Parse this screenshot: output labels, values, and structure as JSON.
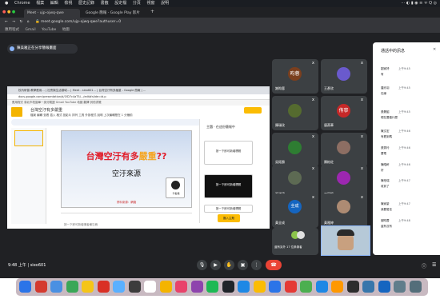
{
  "menubar": {
    "items": [
      "Chrome",
      "檔案",
      "編輯",
      "檢視",
      "歷史記錄",
      "書籤",
      "設定檔",
      "分頁",
      "視窗",
      "說明"
    ],
    "right": "⋯ ◐ ▮ ◉ ≡ ᯤ Q ◎"
  },
  "browser_tabs": [
    {
      "label": "Meet - ujp-ojwq-qwe",
      "color": "#35363a"
    },
    {
      "label": "Google 簡報 - Google Play 影片",
      "color": "#202124"
    }
  ],
  "address": {
    "url": "meet.google.com/ujp-ojwq-qwe?authuser=0"
  },
  "bookmarks": [
    "應用程式",
    "Gmail",
    "YouTube",
    "地圖"
  ],
  "meet": {
    "presenter": "陳美雅正在分享簡報畫面",
    "time": "9:48 上午",
    "meeting_code": "sieo601",
    "more_count": "還有另外 17 位參與者"
  },
  "shared": {
    "inner_tabs": [
      "校內研習-教學應用…",
      "社會與生活領域…",
      "Meet - sieo601…",
      "台灣空汙有多嚴重 - Google 簡報",
      "…"
    ],
    "inner_url": "docs.google.com/presentation/d/1fD7c4aT5J…/edit#slide=id.p",
    "inner_bookmarks": "應用程式  臺北市校園單一身分驗證  Gmail  YouTube  地圖  翻譯  其他書籤",
    "doc_title": "台灣空汙有多嚴重",
    "menu": "檔案 編輯 查看 插入 格式 投影片 排列 工具 外掛程式 說明  上次編輯是在 1 分鐘前",
    "slide_title_a": "台灣空汙有多",
    "slide_title_b": "嚴重",
    "slide_title_c": "??",
    "slide_sub": "空汙來源",
    "slide_footer": "資料來源：網路",
    "slide_badge": "平板機",
    "notes": "按一下即可新增講者備忘稿",
    "right_panel_title": "主題",
    "right_panel_sub": "在這份簡報中",
    "right_cards": [
      "按一下即可新增標題",
      "按一下即可新增標題",
      "按一下即可新增標題"
    ],
    "right_button": "匯入主題"
  },
  "participants": [
    {
      "name": "謝昀蓉",
      "initial": "昀蓉",
      "color": "#7b3f1e"
    },
    {
      "name": "王彥欣",
      "initial": "",
      "color": "#6a5acd"
    },
    {
      "name": "陳瑞玟",
      "initial": "",
      "color": "#556b2f"
    },
    {
      "name": "唐燕華",
      "initial": "侑寧",
      "color": "#c62828"
    },
    {
      "name": "吳銘勝",
      "initial": "",
      "color": "#2e7d32"
    },
    {
      "name": "陳彬佐",
      "initial": "",
      "color": "#8d6e63"
    },
    {
      "name": "張道瑋",
      "initial": "",
      "color": "#5d6a53"
    },
    {
      "name": "丁昱銘",
      "initial": "",
      "color": "#9c27b0"
    },
    {
      "name": "黃全成",
      "initial": "全成",
      "color": "#1565c0"
    },
    {
      "name": "黃雅婷",
      "initial": "",
      "color": "#ad8b73"
    }
  ],
  "chat": {
    "title": "通話中的訊息",
    "messages": [
      {
        "name": "劉家妤",
        "time": "上午9:45",
        "text": "有"
      },
      {
        "name": "唐欣羽",
        "time": "上午9:45",
        "text": "在線"
      },
      {
        "name": "張晏韶",
        "time": "上午9:45",
        "text": "現在要做什麼"
      },
      {
        "name": "陳文宏",
        "time": "上午9:46",
        "text": "有看到嗎"
      },
      {
        "name": "張秀玲",
        "time": "上午9:46",
        "text": "要電"
      },
      {
        "name": "陳皓軒",
        "time": "上午9:46",
        "text": "好"
      },
      {
        "name": "陳柏瑞",
        "time": "上午9:47",
        "text": "收到了"
      },
      {
        "name": "陳家豪",
        "time": "上午9:47",
        "text": "我要發言"
      },
      {
        "name": "謝昀蓉",
        "time": "上午9:48",
        "text": "還有沒有"
      }
    ]
  },
  "controls": [
    "mic",
    "camera",
    "hand",
    "present",
    "more",
    "hangup"
  ],
  "dock_colors": [
    "#2b74e8",
    "#d43a2f",
    "#4a90e2",
    "#3aa757",
    "#f5c518",
    "#d93025",
    "#5ab0ff",
    "#3c3c3c",
    "#ffffff",
    "#f4b400",
    "#e8436b",
    "#8e44ad",
    "#1db954",
    "#20242a",
    "#1e88e5",
    "#fbbc04",
    "#2b74e8",
    "#e53935",
    "#4caf50",
    "#1e88e5",
    "#ff9800",
    "#2d2d2d",
    "#3776ab",
    "#1565c0",
    "#607d8b",
    "#546e7a"
  ]
}
